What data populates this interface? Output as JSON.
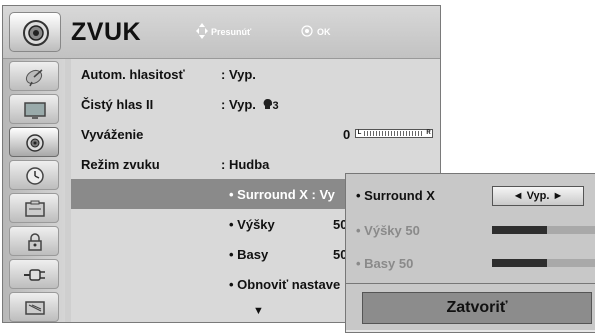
{
  "header": {
    "title": "ZVUK",
    "hint_move": "Presunúť",
    "hint_ok": "OK"
  },
  "sidebar": {
    "items": [
      {
        "icon": "satellite-dish-icon",
        "selected": false
      },
      {
        "icon": "tv-screen-icon",
        "selected": false
      },
      {
        "icon": "speaker-icon",
        "selected": true
      },
      {
        "icon": "clock-icon",
        "selected": false
      },
      {
        "icon": "options-icon",
        "selected": false
      },
      {
        "icon": "lock-icon",
        "selected": false
      },
      {
        "icon": "input-plug-icon",
        "selected": false
      },
      {
        "icon": "usb-media-icon",
        "selected": false
      }
    ]
  },
  "menu": {
    "auto_volume": {
      "label": "Autom. hlasitosť",
      "value": ": Vyp."
    },
    "clear_voice": {
      "label": "Čistý hlas II",
      "value": ": Vyp.",
      "level": "3"
    },
    "balance": {
      "label": "Vyváženie",
      "value": "0",
      "bar_left": "L",
      "bar_right": "R"
    },
    "sound_mode": {
      "label": "Režim zvuku",
      "value": ": Hudba"
    },
    "surround": {
      "label": "• Surround X : Vy"
    },
    "treble": {
      "label": "• Výšky",
      "value": "50"
    },
    "bass": {
      "label": "• Basy",
      "value": "50"
    },
    "reset": {
      "label": "• Obnoviť nastave"
    },
    "more_arrow": "▼"
  },
  "popup": {
    "surround_label": "• Surround X",
    "surround_value": "◄ Vyp. ►",
    "treble_label": "• Výšky 50",
    "treble_level": 0.5,
    "bass_label": "• Basy 50",
    "bass_level": 0.5,
    "close_label": "Zatvoriť"
  },
  "colors": {
    "highlight": "#8a8a8a",
    "bar_fill": "#2e2e2e"
  }
}
